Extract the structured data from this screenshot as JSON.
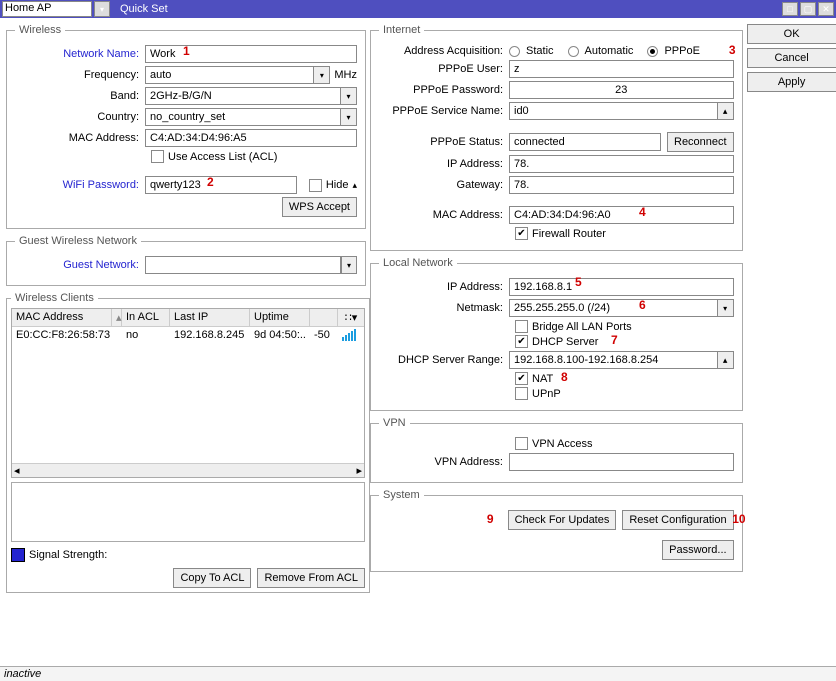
{
  "titlebar": {
    "mode": "Home AP",
    "title": "Quick Set"
  },
  "buttons": {
    "ok": "OK",
    "cancel": "Cancel",
    "apply": "Apply"
  },
  "wireless": {
    "legend": "Wireless",
    "network_name_label": "Network Name:",
    "network_name": "Work",
    "frequency_label": "Frequency:",
    "frequency": "auto",
    "frequency_unit": "MHz",
    "band_label": "Band:",
    "band": "2GHz-B/G/N",
    "country_label": "Country:",
    "country": "no_country_set",
    "mac_label": "MAC Address:",
    "mac": "C4:AD:34:D4:96:A5",
    "acl_label": "Use Access List (ACL)",
    "wifi_pw_label": "WiFi Password:",
    "wifi_pw": "qwerty123",
    "hide_label": "Hide",
    "wps": "WPS Accept"
  },
  "guest": {
    "legend": "Guest Wireless Network",
    "label": "Guest Network:"
  },
  "clients": {
    "legend": "Wireless Clients",
    "headers": {
      "mac": "MAC Address",
      "acl": "In ACL",
      "last": "Last IP",
      "up": "Uptime"
    },
    "rows": [
      {
        "mac": "E0:CC:F8:26:58:73",
        "acl": "no",
        "ip": "192.168.8.245",
        "up": "9d 04:50:..",
        "sig": "-50"
      }
    ]
  },
  "signal": {
    "label": "Signal Strength:"
  },
  "bottom": {
    "copy": "Copy To ACL",
    "remove": "Remove From ACL"
  },
  "internet": {
    "legend": "Internet",
    "acq_label": "Address Acquisition:",
    "acq": {
      "static": "Static",
      "auto": "Automatic",
      "pppoe": "PPPoE",
      "selected": "pppoe"
    },
    "user_label": "PPPoE User:",
    "user": "z",
    "pw_label": "PPPoE Password:",
    "pw": "23",
    "svc_label": "PPPoE Service Name:",
    "svc": "id0",
    "status_label": "PPPoE Status:",
    "status": "connected",
    "reconnect": "Reconnect",
    "ip_label": "IP Address:",
    "ip": "78.",
    "gw_label": "Gateway:",
    "gw": "78.",
    "mac_label": "MAC Address:",
    "mac": "C4:AD:34:D4:96:A0",
    "fw_label": "Firewall Router"
  },
  "local": {
    "legend": "Local Network",
    "ip_label": "IP Address:",
    "ip": "192.168.8.1",
    "mask_label": "Netmask:",
    "mask": "255.255.255.0 (/24)",
    "bridge_label": "Bridge All LAN Ports",
    "dhcp_label": "DHCP Server",
    "range_label": "DHCP Server Range:",
    "range": "192.168.8.100-192.168.8.254",
    "nat_label": "NAT",
    "upnp_label": "UPnP"
  },
  "vpn": {
    "legend": "VPN",
    "access_label": "VPN Access",
    "addr_label": "VPN Address:"
  },
  "system": {
    "legend": "System",
    "check": "Check For Updates",
    "reset": "Reset Configuration",
    "password": "Password..."
  },
  "status": "inactive",
  "annotations": {
    "a1": "1",
    "a2": "2",
    "a3": "3",
    "a4": "4",
    "a5": "5",
    "a6": "6",
    "a7": "7",
    "a8": "8",
    "a9": "9",
    "a10": "10"
  }
}
